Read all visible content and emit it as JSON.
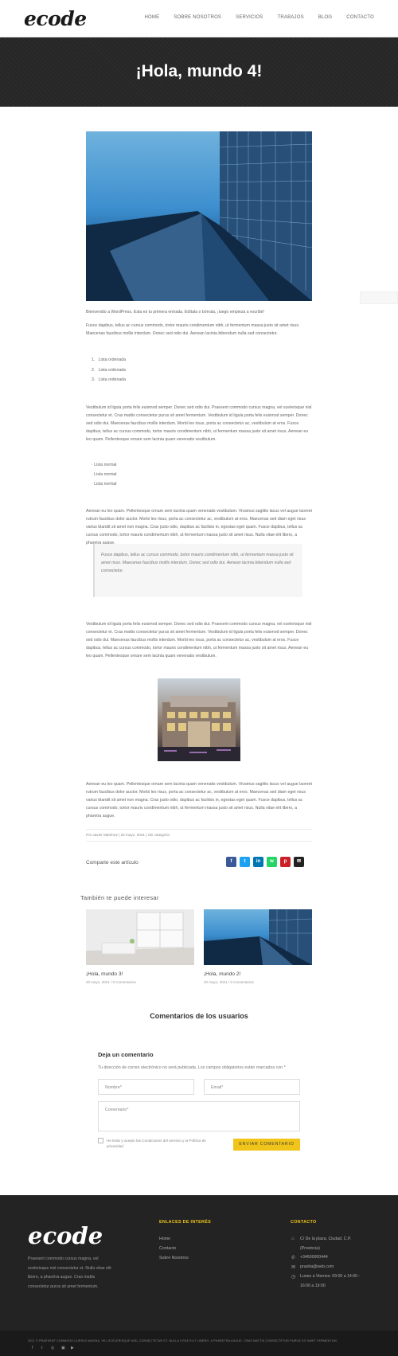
{
  "header": {
    "logo": "ecode",
    "nav": [
      "HOME",
      "SOBRE NOSOTROS",
      "SERVICIOS",
      "TRABAJOS",
      "BLOG",
      "CONTACTO"
    ]
  },
  "hero": {
    "title": "¡Hola, mundo 4!"
  },
  "article": {
    "intro": "Bienvenido a WordPress. Esta es tu primera entrada. Edítala o bórrala, ¡luego empieza a escribir!",
    "p1": "Fusce dapibus, tellus ac cursus commodo, tortor mauris condimentum nibh, ut fermentum massa justo sit amet risus. Maecenas faucibus mollis interdum. Donec sed odio dui. Aenean lacinia bibendum nulla sed consectetur.",
    "ordered": [
      "Lista ordenada",
      "Lista ordenada",
      "Lista ordenada"
    ],
    "p2": "Vestibulum id ligula porta felis euismod semper. Donec sed odio dui. Praesent commodo cursus magna, vel scelerisque nisl consectetur et. Cras mattis consectetur purus sit amet fermentum. Vestibulum id ligula porta felis euismod semper. Donec sed odio dui. Maecenas faucibus mollis interdum. Morbi leo risus, porta ac consectetur ac, vestibulum at eros. Fusce dapibus, tellus ac cursus commodo, tortor mauris condimentum nibh, ut fermentum massa justo sit amet risus. Aenean eu leo quam. Pellentesque ornare sem lacinia quam venenatis vestibulum.",
    "unordered": [
      "Lista normal",
      "Lista normal",
      "Lista normal"
    ],
    "p3": "Aenean eu leo quam. Pellentesque ornare sem lacinia quam venenatis vestibulum. Vivamus sagittis lacus vel augue laoreet rutrum faucibus dolor auctor. Morbi leo risus, porta ac consectetur ac, vestibulum at eros. Maecenas sed diam eget risus varius blandit sit amet non magna. Cras justo odio, dapibus ac facilisis in, egestas eget quam. Fusce dapibus, tellus ac cursus commodo, tortor mauris condimentum nibh, ut fermentum massa justo sit amet risus. Nulla vitae elit libero, a pharetra augue.",
    "quote": "Fusce dapibus, tellus ac cursus commodo, tortor mauris condimentum nibh, ut fermentum massa justo sit amet risus. Maecenas faucibus mollis interdum. Donec sed odio dui. Aenean lacinia bibendum nulla sed consectetur.",
    "p4": "Vestibulum id ligula porta felis euismod semper. Donec sed odio dui. Praesent commodo cursus magna, vel scelerisque nisl consectetur et. Cras mattis consectetur purus sit amet fermentum. Vestibulum id ligula porta felis euismod semper. Donec sed odio dui. Maecenas faucibus mollis interdum. Morbi leo risus, porta ac consectetur ac, vestibulum at eros. Fusce dapibus, tellus ac cursus commodo, tortor mauris condimentum nibh, ut fermentum massa justo sit amet risus. Aenean eu leo quam. Pellentesque ornare sem lacinia quam venenatis vestibulum.",
    "p5": "Aenean eu leo quam. Pellentesque ornare sem lacinia quam venenatis vestibulum. Vivamus sagittis lacus vel augue laoreet rutrum faucibus dolor auctor. Morbi leo risus, porta ac consectetur ac, vestibulum at eros. Maecenas sed diam eget risus varius blandit sit amet non magna. Cras justo odio, dapibus ac facilisis in, egestas eget quam. Fusce dapibus, tellus ac cursus commodo, tortor mauris condimentum nibh, ut fermentum massa justo sit amet risus. Nulla vitae elit libero, a pharetra augue.",
    "meta": "Por Javier Martínez | 20 mayo, 2021 | Sin categoría"
  },
  "share": {
    "label": "Comparte este artículo",
    "buttons": [
      {
        "icon": "facebook-icon",
        "glyph": "f",
        "color": "#3b5998"
      },
      {
        "icon": "twitter-icon",
        "glyph": "t",
        "color": "#1da1f2"
      },
      {
        "icon": "linkedin-icon",
        "glyph": "in",
        "color": "#0077b5"
      },
      {
        "icon": "whatsapp-icon",
        "glyph": "w",
        "color": "#25d366"
      },
      {
        "icon": "pinterest-icon",
        "glyph": "p",
        "color": "#cb2027"
      },
      {
        "icon": "email-icon",
        "glyph": "✉",
        "color": "#222222"
      }
    ]
  },
  "related": {
    "heading": "También te puede interesar",
    "posts": [
      {
        "title": "¡Hola, mundo 3!",
        "meta": "20 mayo, 2021 / 0 Comentarios"
      },
      {
        "title": "¡Hola, mundo 2!",
        "meta": "20 mayo, 2021 / 0 Comentarios"
      }
    ]
  },
  "comments": {
    "title": "Comentarios de los usuarios",
    "reply_title": "Deja un comentario",
    "note": "Tu dirección de correo electrónico no será publicada. Los campos obligatorios están marcados con *",
    "name_placeholder": "Nombre*",
    "email_placeholder": "Email*",
    "comment_placeholder": "Comentario*",
    "consent": "He leído y acepto las Condiciones del servicio y la Política de privacidad",
    "submit": "ENVIAR COMENTARIO"
  },
  "footer": {
    "logo": "ecode",
    "about": "Praesent commodo cursus magna, vel scelerisque nisl consectetur et. Nulla vitae elit libero, a pharetra augue. Cras mattis consectetur purus sit amet fermentum.",
    "links_heading": "ENLACES DE INTERÉS",
    "links": [
      "Home",
      "Contacto",
      "Sobre Nosotros"
    ],
    "contact_heading": "CONTACTO",
    "address_line1": "C/ De la plaza, Ciudad, C.P.",
    "address_line2": "(Provincia)",
    "phone": "+34600000444",
    "email": "prueba@web.com",
    "hours_line1": "Lunes a Viernes: 09:00 a 14:00 -",
    "hours_line2": "16:00 a 19:00",
    "copyright": "2021 © PRAESENT COMMODO CURSUS MAGNA, VEL SCELERISQUE NISL CONSECTETUR ET. NULLA VITAE ELIT LIBERO, A PHARETRA AUGUE. CRAS MATTIS CONSECTETUR PURUS SIT AMET FERMENTUM."
  }
}
